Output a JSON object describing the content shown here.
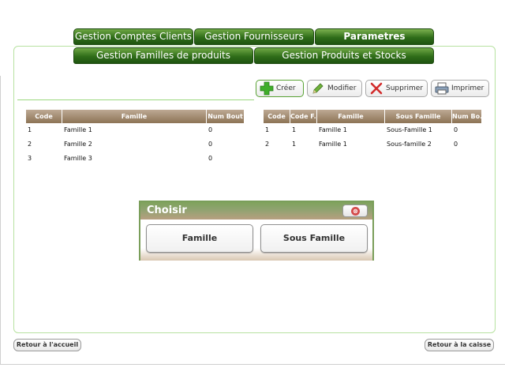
{
  "tabs_top": [
    {
      "label": "Gestion Comptes Clients"
    },
    {
      "label": "Gestion Fournisseurs"
    },
    {
      "label": "Parametres"
    }
  ],
  "tabs_sub": [
    {
      "label": "Gestion Familles de produits"
    },
    {
      "label": "Gestion Produits et Stocks"
    }
  ],
  "toolbar": {
    "creer": "Créer",
    "modifier": "Modifier",
    "supprimer": "Supprimer",
    "imprimer": "Imprimer"
  },
  "familles_table": {
    "headers": [
      "Code",
      "Famille",
      "Num Bout"
    ],
    "rows": [
      [
        "1",
        "Famille 1",
        "0"
      ],
      [
        "2",
        "Famille 2",
        "0"
      ],
      [
        "3",
        "Famille 3",
        "0"
      ]
    ]
  },
  "sousfamilles_table": {
    "headers": [
      "Code",
      "Code F...",
      "Famille",
      "Sous Famille",
      "Num Bo..."
    ],
    "rows": [
      [
        "1",
        "1",
        "Famille 1",
        "Sous-Famille 1",
        "0"
      ],
      [
        "2",
        "1",
        "Famille 1",
        "Sous-famille 2",
        "0"
      ]
    ]
  },
  "dialog": {
    "title": "Choisir",
    "close_glyph": "⊗",
    "option_famille": "Famille",
    "option_sous_famille": "Sous Famille"
  },
  "footer": {
    "retour_accueil": "Retour à l'accueil",
    "retour_caisse": "Retour à la caisse"
  },
  "colors": {
    "tab_green": "#2f6d19",
    "panel_border": "#b7e2a0",
    "grid_header": "#8c7355",
    "close_red": "#d44b4b"
  }
}
